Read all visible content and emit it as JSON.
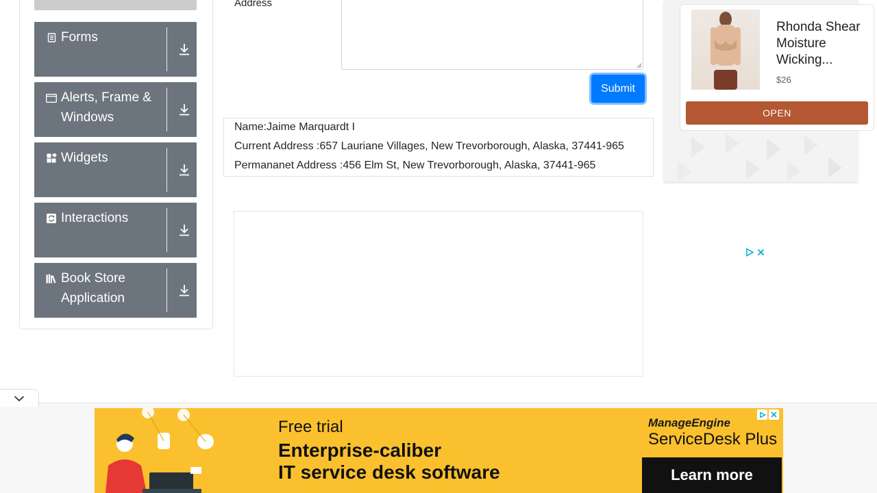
{
  "sidebar": {
    "groups": [
      {
        "label": "Forms",
        "icon": "document-icon"
      },
      {
        "label": "Alerts, Frame & Windows",
        "icon": "window-icon"
      },
      {
        "label": "Widgets",
        "icon": "widgets-icon"
      },
      {
        "label": "Interactions",
        "icon": "interactions-icon"
      },
      {
        "label": "Book Store Application",
        "icon": "books-icon"
      }
    ]
  },
  "form": {
    "address_label": "Address",
    "submit_label": "Submit"
  },
  "output": {
    "name": "Name:Jaime Marquardt I",
    "current_address": "Current Address :657 Lauriane Villages, New Trevorborough, Alaska, 37441-965",
    "permanent_address": "Permananet Address :456 Elm St, New Trevorborough, Alaska, 37441-965"
  },
  "side_ad": {
    "title": "Rhonda Shear Moisture Wicking...",
    "price": "$26",
    "open_label": "OPEN"
  },
  "banner_ad": {
    "line1": "Free trial",
    "line2": "Enterprise-caliber",
    "line3": "IT service desk software",
    "brand": "ManageEngine",
    "product": "ServiceDesk Plus",
    "cta": "Learn more",
    "accent": "#fbc02d"
  },
  "colors": {
    "sidebar_group": "#6c757d",
    "submit": "#007bff",
    "ad_open": "#b45733"
  }
}
